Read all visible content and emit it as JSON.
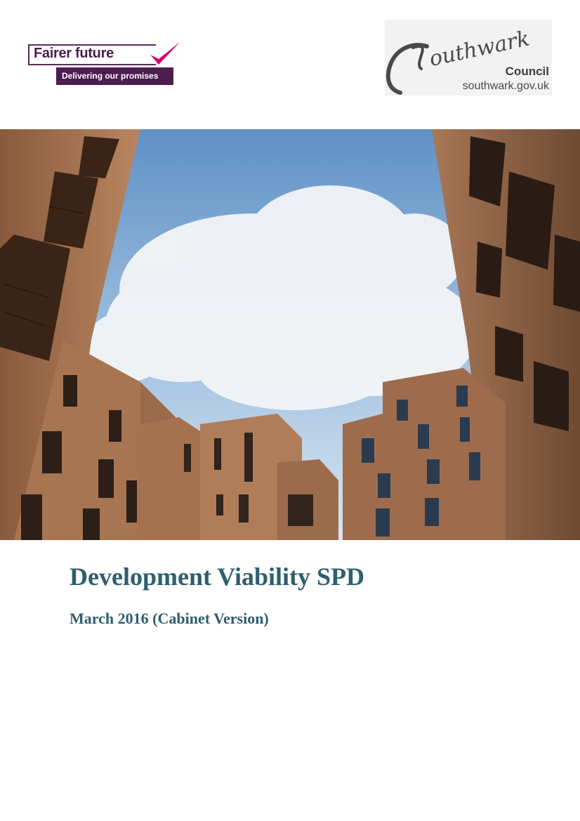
{
  "logos": {
    "fairer_future": {
      "title": "Fairer future",
      "tagline": "Delivering our promises",
      "border_color": "#5a2a5c",
      "tick_color": "#d4006f"
    },
    "southwark": {
      "wordmark": "Southwark",
      "council": "Council",
      "url": "southwark.gov.uk"
    }
  },
  "cover_photo": {
    "subject": "brick apartment buildings against a cloudy blue sky"
  },
  "document": {
    "title": "Development Viability SPD",
    "subtitle": "March 2016 (Cabinet Version)",
    "heading_color": "#2e5f6e"
  }
}
